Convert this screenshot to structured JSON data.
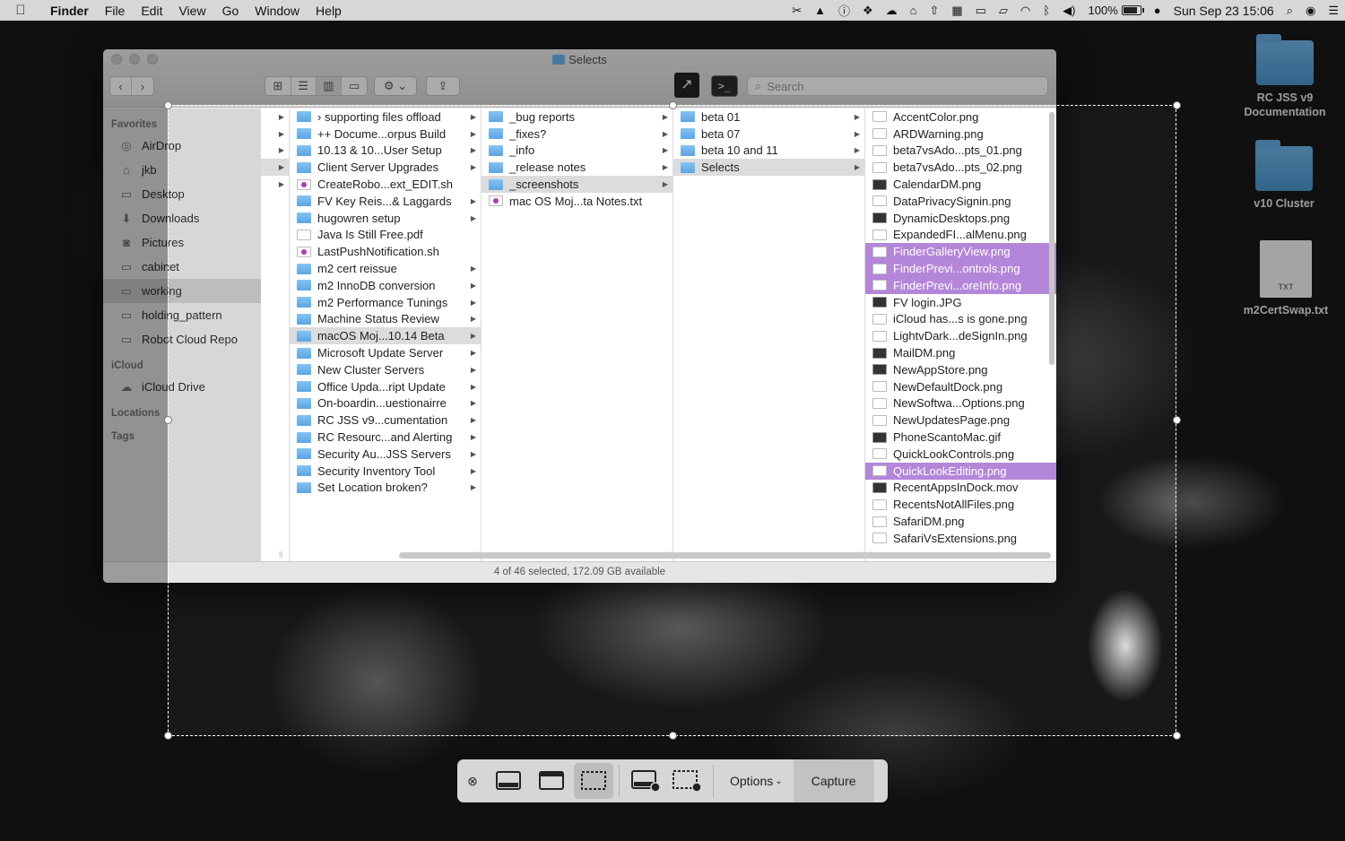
{
  "menubar": {
    "app": "Finder",
    "items": [
      "File",
      "Edit",
      "View",
      "Go",
      "Window",
      "Help"
    ],
    "battery": "100%",
    "clock": "Sun Sep 23  15:06"
  },
  "window": {
    "title": "Selects",
    "search_placeholder": "Search",
    "status": "4 of 46 selected, 172.09 GB available"
  },
  "sidebar": {
    "favorites_header": "Favorites",
    "favorites": [
      "AirDrop",
      "jkb",
      "Desktop",
      "Downloads",
      "Pictures",
      "cabinet",
      "working",
      "holding_pattern",
      "Robot Cloud Repo"
    ],
    "icloud_header": "iCloud",
    "icloud": [
      "iCloud Drive"
    ],
    "locations_header": "Locations",
    "tags_header": "Tags"
  },
  "columns": {
    "col2": [
      {
        "name": "› supporting files offload",
        "type": "folder",
        "arrow": true
      },
      {
        "name": "++ Docume...orpus Build",
        "type": "folder",
        "arrow": true
      },
      {
        "name": "10.13 & 10...User Setup",
        "type": "folder",
        "arrow": true
      },
      {
        "name": "Client Server Upgrades",
        "type": "folder",
        "arrow": true
      },
      {
        "name": "CreateRobo...ext_EDIT.sh",
        "type": "script",
        "arrow": false
      },
      {
        "name": "FV Key Reis...& Laggards",
        "type": "folder",
        "arrow": true
      },
      {
        "name": "hugowren setup",
        "type": "folder",
        "arrow": true
      },
      {
        "name": "Java Is Still Free.pdf",
        "type": "pdf",
        "arrow": false
      },
      {
        "name": "LastPushNotification.sh",
        "type": "script",
        "arrow": false
      },
      {
        "name": "m2 cert reissue",
        "type": "folder",
        "arrow": true
      },
      {
        "name": "m2 InnoDB conversion",
        "type": "folder",
        "arrow": true
      },
      {
        "name": "m2 Performance Tunings",
        "type": "folder",
        "arrow": true
      },
      {
        "name": "Machine Status Review",
        "type": "folder",
        "arrow": true
      },
      {
        "name": "macOS Moj...10.14 Beta",
        "type": "folder",
        "arrow": true,
        "state": "sel"
      },
      {
        "name": "Microsoft Update Server",
        "type": "folder",
        "arrow": true
      },
      {
        "name": "New Cluster Servers",
        "type": "folder",
        "arrow": true
      },
      {
        "name": "Office Upda...ript Update",
        "type": "folder",
        "arrow": true
      },
      {
        "name": "On-boardin...uestionairre",
        "type": "folder",
        "arrow": true
      },
      {
        "name": "RC JSS v9...cumentation",
        "type": "folder",
        "arrow": true
      },
      {
        "name": "RC Resourc...and Alerting",
        "type": "folder",
        "arrow": true
      },
      {
        "name": "Security Au...JSS Servers",
        "type": "folder",
        "arrow": true
      },
      {
        "name": "Security Inventory Tool",
        "type": "folder",
        "arrow": true
      },
      {
        "name": "Set Location broken?",
        "type": "folder",
        "arrow": true
      }
    ],
    "col3": [
      {
        "name": "_bug reports",
        "type": "folder",
        "arrow": true
      },
      {
        "name": "_fixes?",
        "type": "folder",
        "arrow": true
      },
      {
        "name": "_info",
        "type": "folder",
        "arrow": true
      },
      {
        "name": "_release notes",
        "type": "folder",
        "arrow": true
      },
      {
        "name": "_screenshots",
        "type": "folder",
        "arrow": true,
        "state": "sel"
      },
      {
        "name": "mac OS Moj...ta Notes.txt",
        "type": "script",
        "arrow": false
      }
    ],
    "col4": [
      {
        "name": "beta 01",
        "type": "folder",
        "arrow": true
      },
      {
        "name": "beta 07",
        "type": "folder",
        "arrow": true
      },
      {
        "name": "beta 10 and 11",
        "type": "folder",
        "arrow": true
      },
      {
        "name": "Selects",
        "type": "folder",
        "arrow": true,
        "state": "sel"
      }
    ],
    "col5": [
      {
        "name": "AccentColor.png",
        "type": "doc"
      },
      {
        "name": "ARDWarning.png",
        "type": "doc"
      },
      {
        "name": "beta7vsAdo...pts_01.png",
        "type": "doc"
      },
      {
        "name": "beta7vsAdo...pts_02.png",
        "type": "doc"
      },
      {
        "name": "CalendarDM.png",
        "type": "img"
      },
      {
        "name": "DataPrivacySignin.png",
        "type": "doc"
      },
      {
        "name": "DynamicDesktops.png",
        "type": "img"
      },
      {
        "name": "ExpandedFI...alMenu.png",
        "type": "doc"
      },
      {
        "name": "FinderGalleryView.png",
        "type": "doc",
        "state": "hl"
      },
      {
        "name": "FinderPrevi...ontrols.png",
        "type": "doc",
        "state": "hl"
      },
      {
        "name": "FinderPrevi...oreInfo.png",
        "type": "doc",
        "state": "hl"
      },
      {
        "name": "FV login.JPG",
        "type": "img"
      },
      {
        "name": "iCloud has...s is gone.png",
        "type": "doc"
      },
      {
        "name": "LightvDark...deSignIn.png",
        "type": "doc"
      },
      {
        "name": "MailDM.png",
        "type": "img"
      },
      {
        "name": "NewAppStore.png",
        "type": "img"
      },
      {
        "name": "NewDefaultDock.png",
        "type": "doc"
      },
      {
        "name": "NewSoftwa...Options.png",
        "type": "doc"
      },
      {
        "name": "NewUpdatesPage.png",
        "type": "doc"
      },
      {
        "name": "PhoneScantoMac.gif",
        "type": "img"
      },
      {
        "name": "QuickLookControls.png",
        "type": "doc"
      },
      {
        "name": "QuickLookEditing.png",
        "type": "doc",
        "state": "hl"
      },
      {
        "name": "RecentAppsInDock.mov",
        "type": "img"
      },
      {
        "name": "RecentsNotAllFiles.png",
        "type": "doc"
      },
      {
        "name": "SafariDM.png",
        "type": "doc"
      },
      {
        "name": "SafariVsExtensions.png",
        "type": "doc"
      }
    ]
  },
  "desktop": [
    {
      "label": "RC JSS v9 Documentation",
      "type": "folder"
    },
    {
      "label": "v10 Cluster",
      "type": "folder"
    },
    {
      "label": "m2CertSwap.txt",
      "type": "txt",
      "badge": "TXT"
    }
  ],
  "capture_toolbar": {
    "options_label": "Options",
    "capture_label": "Capture"
  }
}
